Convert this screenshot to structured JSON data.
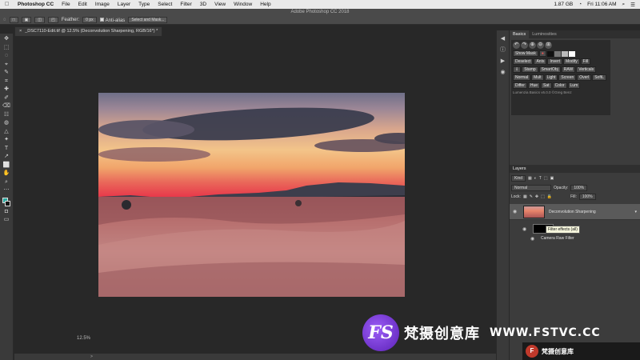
{
  "menubar": {
    "apple": "",
    "items": [
      "Photoshop CC",
      "File",
      "Edit",
      "Image",
      "Layer",
      "Type",
      "Select",
      "Filter",
      "3D",
      "View",
      "Window",
      "Help"
    ],
    "status": {
      "battery": "1.87 GB",
      "time": "Fri 11:06 AM"
    }
  },
  "window": {
    "title": "Adobe Photoshop CC 2018"
  },
  "options": {
    "feather_label": "Feather:",
    "feather_value": "0 px",
    "antialias": "Anti-alias",
    "select_mask": "Select and Mask..."
  },
  "doc_tab": {
    "title": "_DSC7110-Edit.tif @ 12.5% (Deconvolution Sharpening, RGB/16*) *"
  },
  "tools": [
    "✥",
    "⬚",
    "◌",
    "⌖",
    "✎",
    "⌗",
    "✚",
    "✐",
    "⌫",
    "☷",
    "◍",
    "△",
    "✦",
    "T",
    "↗",
    "⬜",
    "✋",
    "⌕",
    "⋯"
  ],
  "side_icons": [
    "◀",
    "ⓘ",
    "▶",
    "◉"
  ],
  "panels": {
    "tab_basics": "Basics",
    "tab_luminosities": "Luminosities",
    "row1_icons": [
      "↶",
      "↷",
      "⊕",
      "⊖",
      "⊞"
    ],
    "show_mask": "Show Mask",
    "row3": [
      "Deselect",
      "Ants",
      "Invert",
      "Modify",
      "Fill"
    ],
    "row4": [
      "Stamp",
      "SmartObj",
      "RAW",
      "Verticals"
    ],
    "row5": [
      "Normal",
      "Mult",
      "Light",
      "Screen",
      "Overl",
      "SoftL"
    ],
    "row6": [
      "Differ",
      "Hue",
      "Sat",
      "Color",
      "Lum"
    ],
    "footer": "Lumenzia Basics v6.0.0 ©Greg Benz"
  },
  "layers": {
    "header": "Layers",
    "kind": "Kind",
    "blend": "Normal",
    "opacity_label": "Opacity:",
    "opacity_value": "100%",
    "lock_label": "Lock:",
    "fill_label": "Fill:",
    "fill_value": "100%",
    "items": [
      {
        "name": "Deconvolution Sharpening"
      },
      {
        "name": ""
      },
      {
        "name": "Camera Raw Filter"
      }
    ],
    "tooltip": "Filter effects (all)"
  },
  "status": {
    "zoom": "12.5%",
    "arrow": ">"
  },
  "watermark": {
    "logo": "FS",
    "cn": "梵摄创意库",
    "site": "WWW.FSTVC.CC"
  },
  "watermark2": {
    "logo": "F",
    "text": "梵摄创意库"
  }
}
